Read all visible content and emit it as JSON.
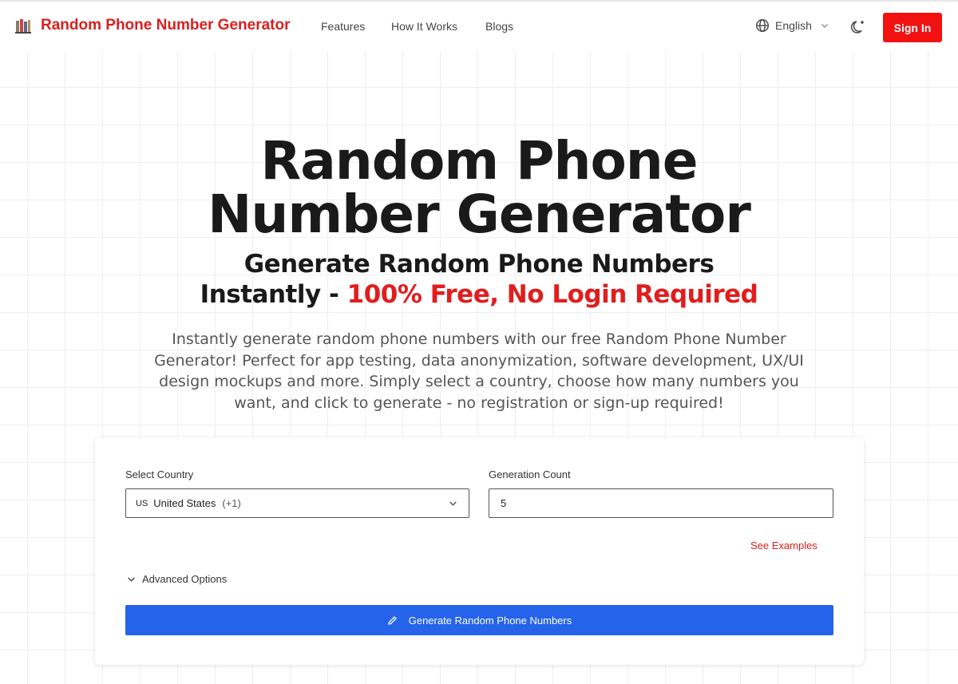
{
  "header": {
    "brand": "Random Phone Number Generator",
    "nav": [
      "Features",
      "How It Works",
      "Blogs"
    ],
    "language": "English",
    "signin_label": "Sign In"
  },
  "hero": {
    "title_line1": "Random Phone",
    "title_line2": "Number Generator",
    "subtitle_line1": "Generate Random Phone Numbers",
    "subtitle_line2_prefix": "Instantly - ",
    "subtitle_line2_highlight": "100% Free, No Login Required",
    "description": "Instantly generate random phone numbers with our free Random Phone Number Generator! Perfect for app testing, data anonymization, software development, UX/UI design mockups and more. Simply select a country, choose how many numbers you want, and click to generate - no registration or sign-up required!"
  },
  "form": {
    "country_label": "Select Country",
    "country_code": "US",
    "country_name": "United States",
    "country_dial": "(+1)",
    "count_label": "Generation Count",
    "count_value": "5",
    "examples_link": "See Examples",
    "advanced_label": "Advanced Options",
    "generate_label": "Generate Random Phone Numbers"
  },
  "colors": {
    "brand_red": "#d92020",
    "signin_red": "#f21111",
    "primary_blue": "#2563eb"
  }
}
